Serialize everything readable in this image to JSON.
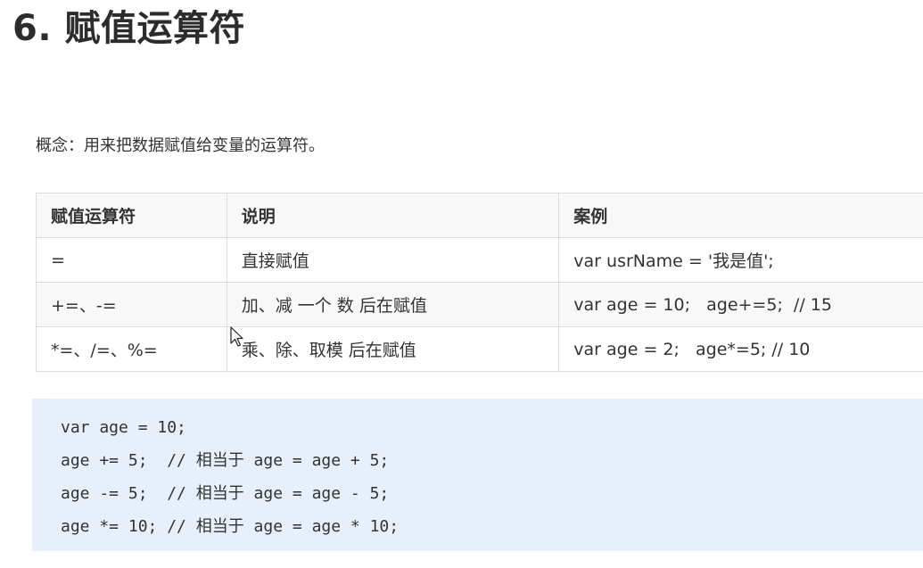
{
  "heading": "6. 赋值运算符",
  "concept": "概念：用来把数据赋值给变量的运算符。",
  "table": {
    "headers": [
      "赋值运算符",
      "说明",
      "案例"
    ],
    "rows": [
      [
        "=",
        "直接赋值",
        "var usrName = '我是值';"
      ],
      [
        "+=、-=",
        "加、减 一个 数 后在赋值",
        "var age = 10;   age+=5;  // 15"
      ],
      [
        "*=、/=、%=",
        "乘、除、取模 后在赋值",
        "var age = 2;   age*=5; // 10"
      ]
    ]
  },
  "code": [
    "var age = 10;",
    "age += 5;  // 相当于 age = age + 5;",
    "age -= 5;  // 相当于 age = age - 5;",
    "age *= 10; // 相当于 age = age * 10;"
  ],
  "cursor": {
    "icon": "mouse-pointer-icon"
  }
}
